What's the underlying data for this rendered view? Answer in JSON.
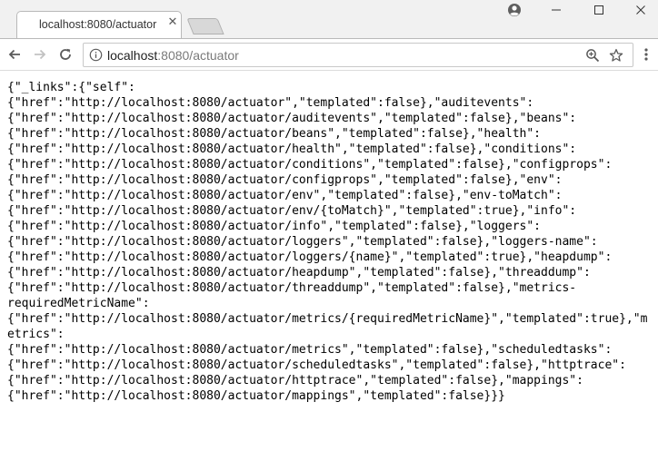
{
  "tab": {
    "title": "localhost:8080/actuator",
    "close_glyph": "✕"
  },
  "address_bar": {
    "host": "localhost",
    "path": ":8080/actuator"
  },
  "icons": {
    "account": "account-icon",
    "minimize": "minimize-icon",
    "maximize": "maximize-icon",
    "close": "close-icon",
    "back": "back-arrow-icon",
    "forward": "forward-arrow-icon",
    "refresh": "refresh-icon",
    "info": "info-icon",
    "zoom": "zoom-icon",
    "bookmark": "star-icon",
    "menu": "kebab-menu-icon"
  },
  "colors": {
    "text": "#000000",
    "url_host": "#222222",
    "url_path": "#7a7a7a",
    "chrome_bg": "#f1f1f1"
  },
  "body_lines": [
    "{\"_links\":{\"self\":",
    "{\"href\":\"http://localhost:8080/actuator\",\"templated\":false},\"auditevents\":",
    "{\"href\":\"http://localhost:8080/actuator/auditevents\",\"templated\":false},\"beans\":",
    "{\"href\":\"http://localhost:8080/actuator/beans\",\"templated\":false},\"health\":",
    "{\"href\":\"http://localhost:8080/actuator/health\",\"templated\":false},\"conditions\":",
    "{\"href\":\"http://localhost:8080/actuator/conditions\",\"templated\":false},\"configprops\":",
    "{\"href\":\"http://localhost:8080/actuator/configprops\",\"templated\":false},\"env\":",
    "{\"href\":\"http://localhost:8080/actuator/env\",\"templated\":false},\"env-toMatch\":",
    "{\"href\":\"http://localhost:8080/actuator/env/{toMatch}\",\"templated\":true},\"info\":",
    "{\"href\":\"http://localhost:8080/actuator/info\",\"templated\":false},\"loggers\":",
    "{\"href\":\"http://localhost:8080/actuator/loggers\",\"templated\":false},\"loggers-name\":",
    "{\"href\":\"http://localhost:8080/actuator/loggers/{name}\",\"templated\":true},\"heapdump\":",
    "{\"href\":\"http://localhost:8080/actuator/heapdump\",\"templated\":false},\"threaddump\":",
    "{\"href\":\"http://localhost:8080/actuator/threaddump\",\"templated\":false},\"metrics-",
    "requiredMetricName\":",
    "{\"href\":\"http://localhost:8080/actuator/metrics/{requiredMetricName}\",\"templated\":true},\"m",
    "etrics\":",
    "{\"href\":\"http://localhost:8080/actuator/metrics\",\"templated\":false},\"scheduledtasks\":",
    "{\"href\":\"http://localhost:8080/actuator/scheduledtasks\",\"templated\":false},\"httptrace\":",
    "{\"href\":\"http://localhost:8080/actuator/httptrace\",\"templated\":false},\"mappings\":",
    "{\"href\":\"http://localhost:8080/actuator/mappings\",\"templated\":false}}}"
  ]
}
